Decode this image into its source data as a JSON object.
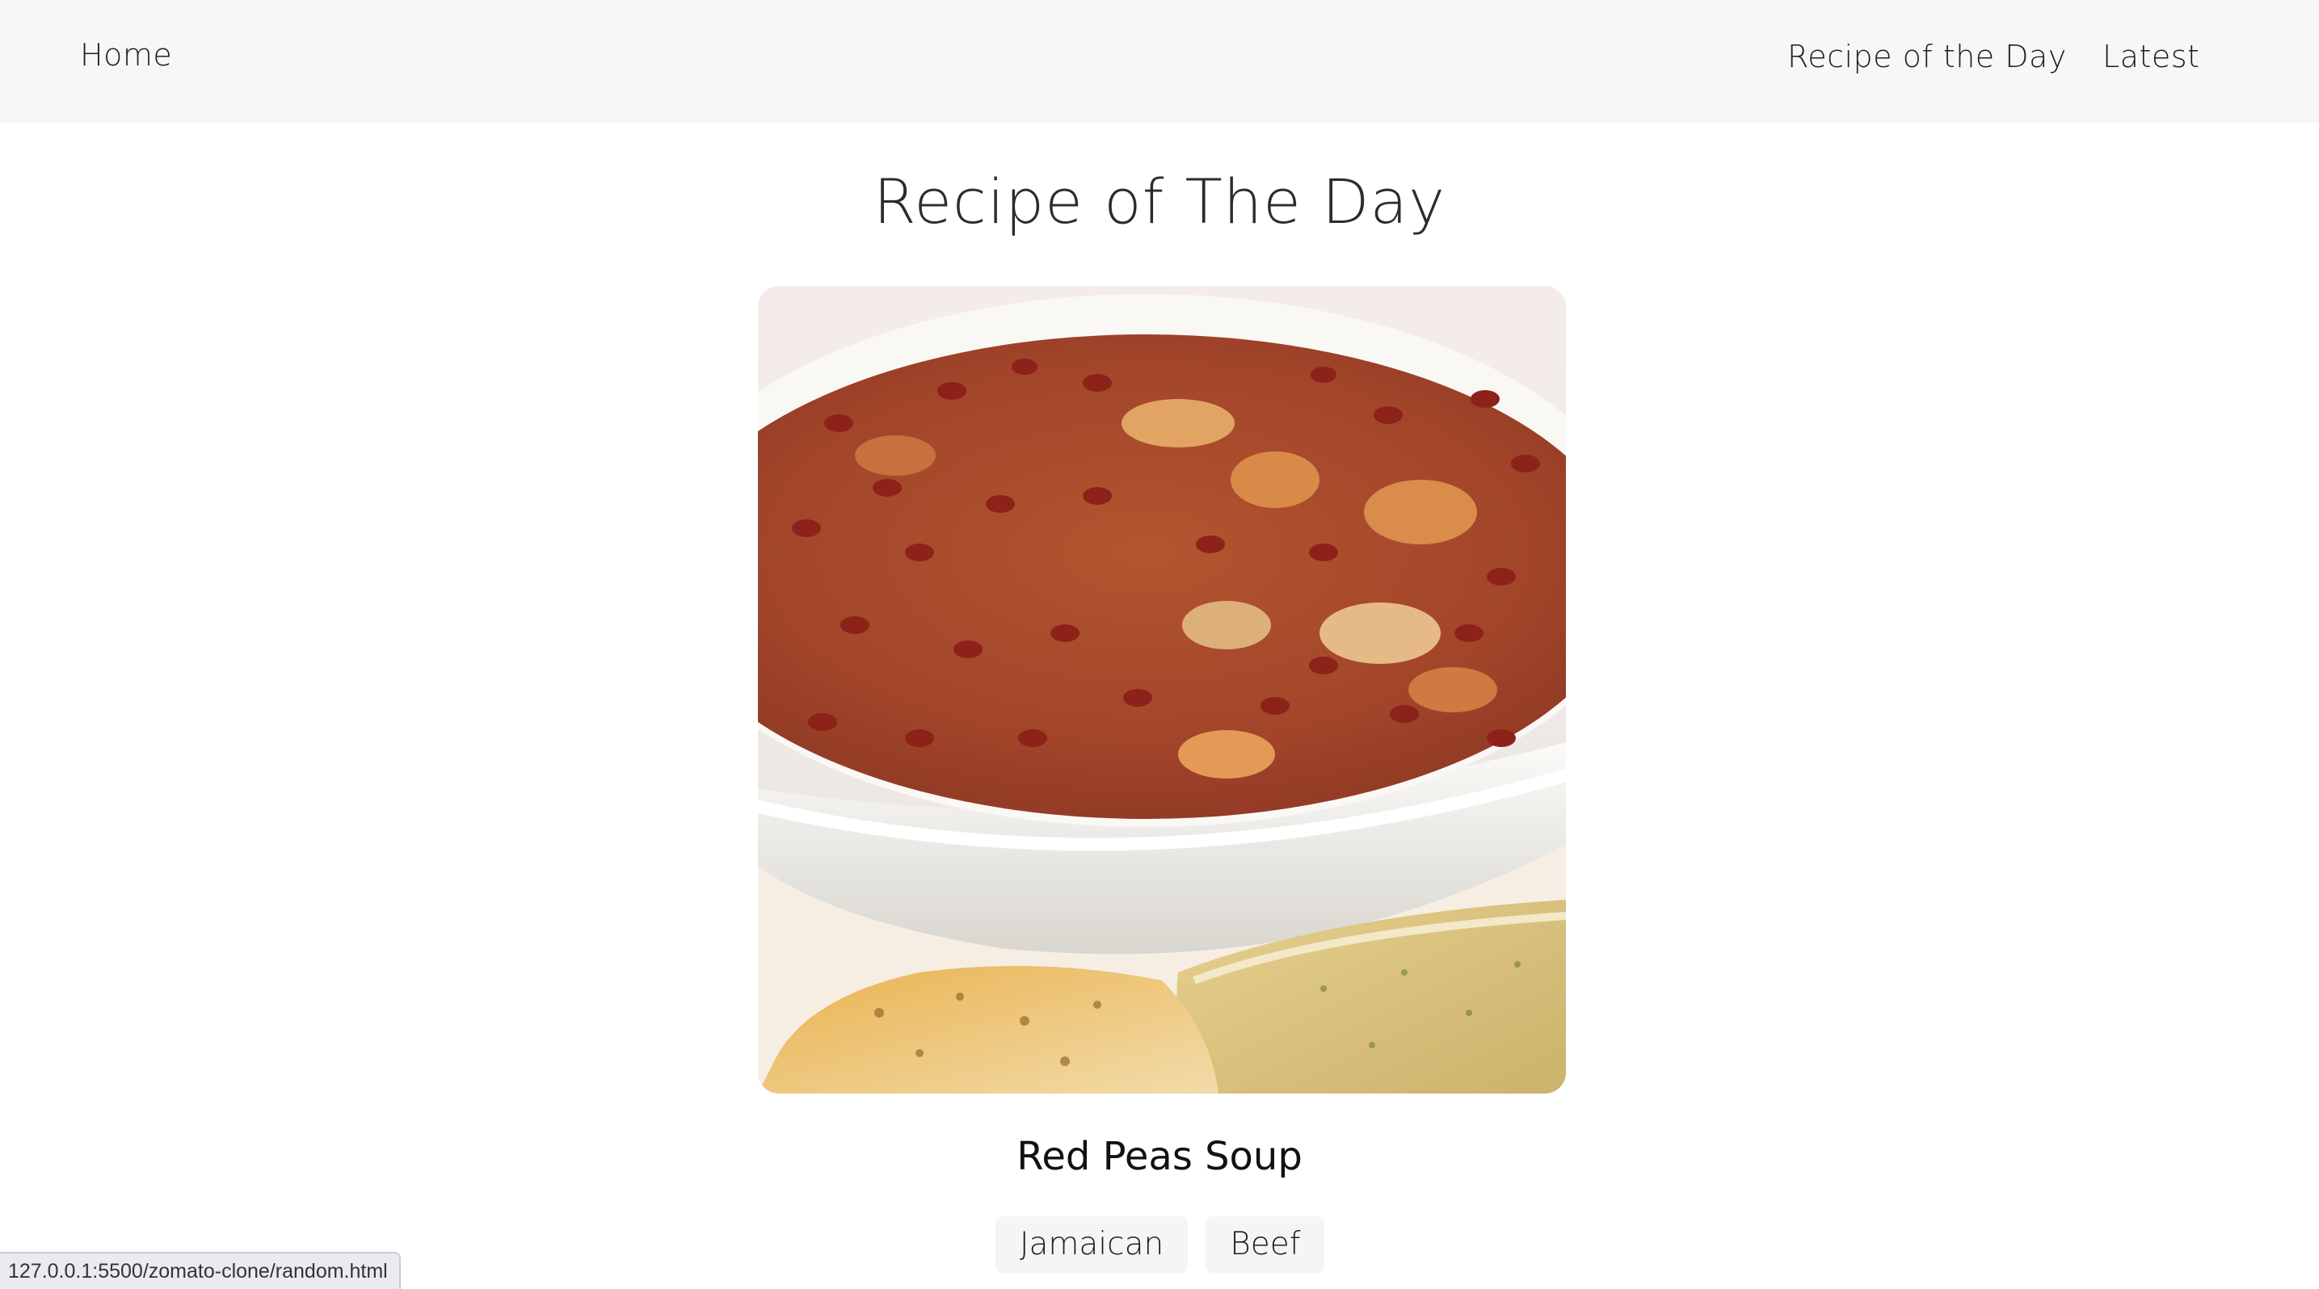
{
  "nav": {
    "home_label": "Home",
    "recipe_of_day_label": "Recipe of the Day",
    "latest_label": "Latest"
  },
  "page": {
    "title": "Recipe of The Day"
  },
  "recipe": {
    "name": "Red Peas Soup",
    "tags": [
      "Jamaican",
      "Beef"
    ]
  },
  "status_bar": {
    "url": "127.0.0.1:5500/zomato-clone/random.html"
  },
  "colors": {
    "navbar_bg": "#f7f7f7",
    "tag_bg": "#f5f5f5",
    "soup": "#a0452a"
  }
}
